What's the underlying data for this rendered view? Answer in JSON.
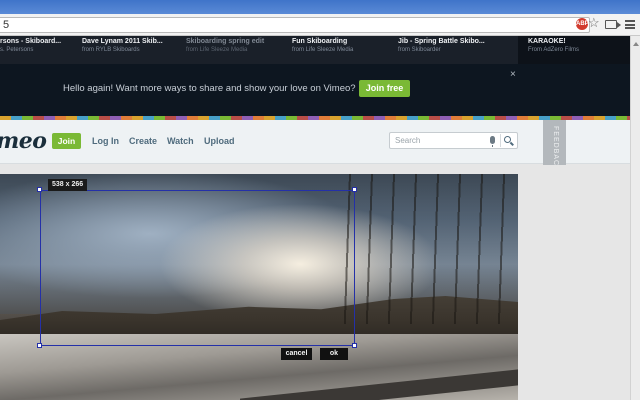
{
  "browser": {
    "url_fragment": "5",
    "extension_badge": "ABP"
  },
  "related_videos": [
    {
      "title": "rsons - Skiboard...",
      "by": "s. Petersons"
    },
    {
      "title": "Dave Lynam 2011 Skib...",
      "by": "from RYLB Skiboards"
    },
    {
      "title": "Skiboarding spring edit",
      "by": "from Life Sleeze Media"
    },
    {
      "title": "Fun Skiboarding",
      "by": "from Life Sleeze Media"
    },
    {
      "title": "Jib - Spring Battle Skibo...",
      "by": "from Skiboarder"
    }
  ],
  "featured_video": {
    "title": "KARAOKE!",
    "by": "From AdZero Films"
  },
  "banner": {
    "message": "Hello again! Want more ways to share and show your love on Vimeo?",
    "join_label": "Join free",
    "close_label": "×"
  },
  "header": {
    "logo_text": "meo",
    "join_label": "Join",
    "nav": [
      "Log In",
      "Create",
      "Watch",
      "Upload"
    ],
    "search_placeholder": "Search",
    "feedback_label": "FEEDBACK"
  },
  "capture": {
    "size_label": "538 x 266",
    "cancel_label": "cancel",
    "ok_label": "ok"
  },
  "colors": {
    "accent_green": "#7ab935",
    "selection_blue": "#2430a8",
    "chrome_blue": "#3f74c9"
  }
}
